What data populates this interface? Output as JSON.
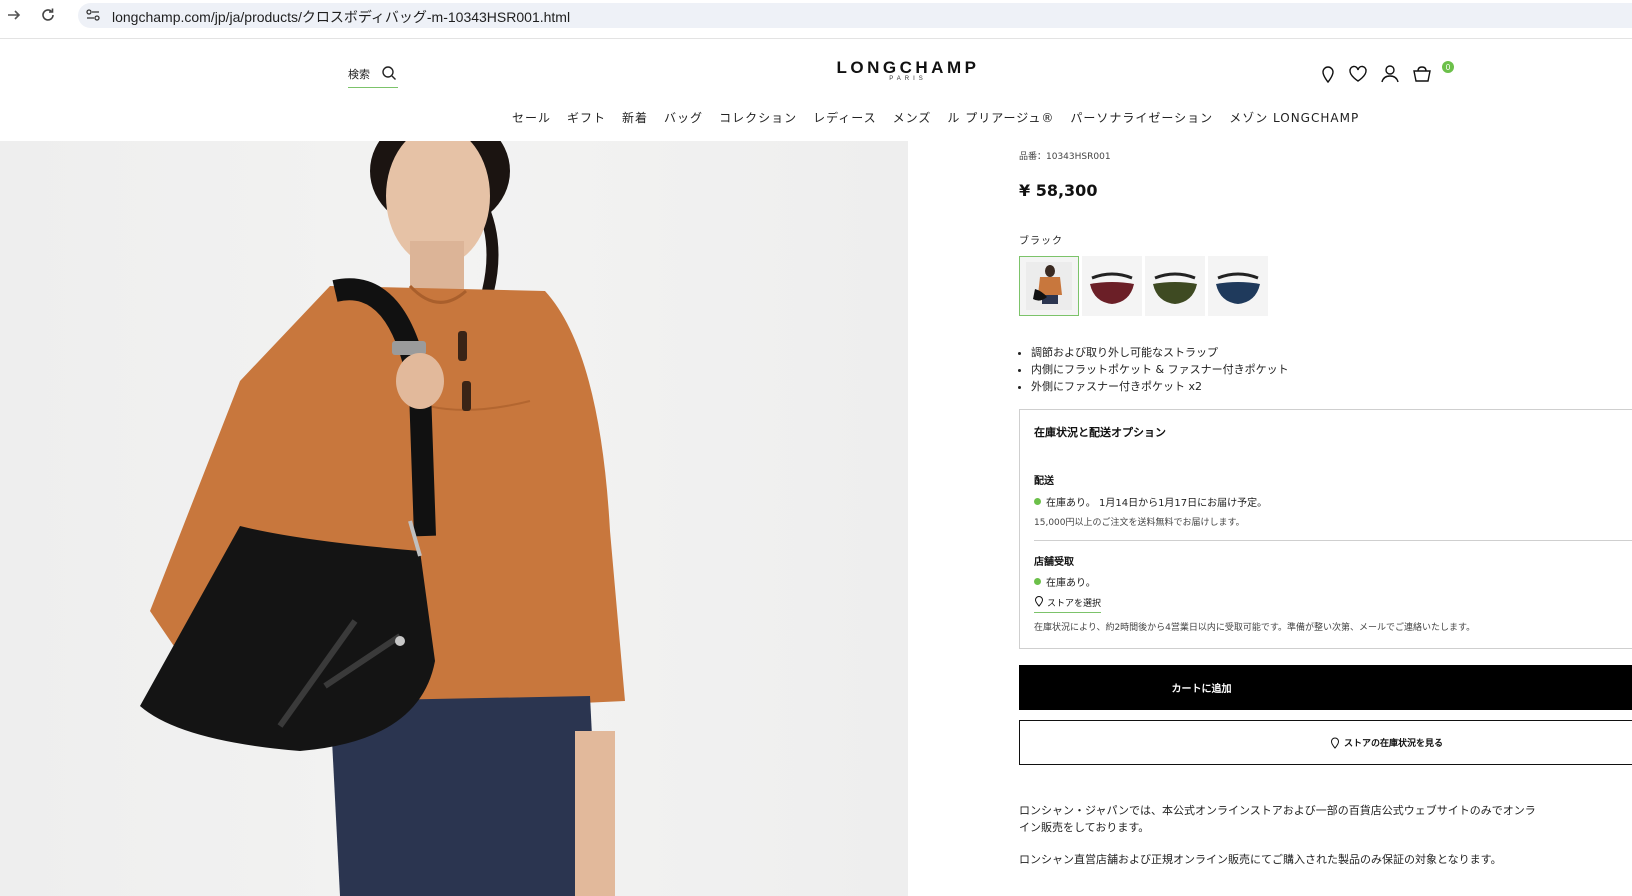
{
  "browser": {
    "url": "longchamp.com/jp/ja/products/クロスボディバッグ-m-10343HSR001.html"
  },
  "header": {
    "search_label": "検索",
    "logo_main": "LONGCHAMP",
    "logo_sub": "PARIS",
    "cart_count": "0"
  },
  "nav": {
    "items": [
      "セール",
      "ギフト",
      "新着",
      "バッグ",
      "コレクション",
      "レディース",
      "メンズ",
      "ル プリアージュ®",
      "パーソナライゼーション",
      "メゾン LONGCHAMP"
    ]
  },
  "product": {
    "sku": "品番：10343HSR001",
    "price": "¥ 58,300",
    "color_name": "ブラック",
    "swatches": [
      {
        "name": "black-model",
        "color": "#1a1a1a"
      },
      {
        "name": "burgundy",
        "color": "#6b1f27"
      },
      {
        "name": "khaki",
        "color": "#3e4a22"
      },
      {
        "name": "navy",
        "color": "#1f3a5c"
      }
    ],
    "features": [
      "調節および取り外し可能なストラップ",
      "内側にフラットポケット & ファスナー付きポケット",
      "外側にファスナー付きポケット x2"
    ]
  },
  "availability": {
    "title": "在庫状況と配送オプション",
    "shipping_title": "配送",
    "shipping_status": "在庫あり。 1月14日から1月17日にお届け予定。",
    "shipping_note": "15,000円以上のご注文を送料無料でお届けします。",
    "pickup_title": "店舗受取",
    "pickup_status": "在庫あり。",
    "select_store": "ストアを選択",
    "pickup_note": "在庫状況により、約2時間後から4営業日以内に受取可能です。準備が整い次第、メールでご連絡いたします。"
  },
  "actions": {
    "add_to_cart": "カートに追加",
    "store_stock": "ストアの在庫状況を見る"
  },
  "disclaimer": {
    "line1": "ロンシャン・ジャパンでは、本公式オンラインストアおよび一部の百貨店公式ウェブサイトのみでオンライン販売をしております。",
    "line2": "ロンシャン直営店舗および正規オンライン販売にてご購入された製品のみ保証の対象となります。"
  },
  "colors": {
    "accent_green": "#7cc36a",
    "shirt_orange": "#c8773d"
  }
}
